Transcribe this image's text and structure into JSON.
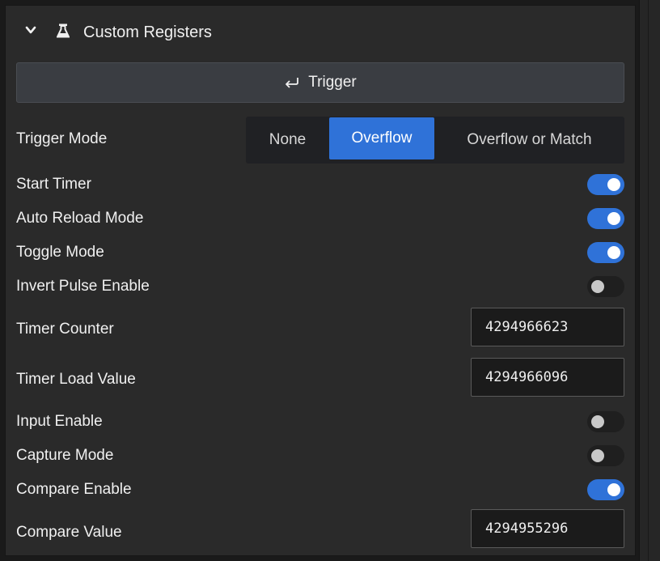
{
  "section": {
    "title": "Custom Registers",
    "collapse_icon": "chevron-down-icon",
    "icon": "flask-icon"
  },
  "trigger_button": {
    "label": "Trigger",
    "icon": "enter-return-icon"
  },
  "trigger_mode": {
    "label": "Trigger Mode",
    "options": [
      "None",
      "Overflow",
      "Overflow or Match"
    ],
    "selected": "Overflow"
  },
  "fields": {
    "start_timer": {
      "label": "Start Timer",
      "enabled": true
    },
    "auto_reload_mode": {
      "label": "Auto Reload Mode",
      "enabled": true
    },
    "toggle_mode": {
      "label": "Toggle Mode",
      "enabled": true
    },
    "invert_pulse_enable": {
      "label": "Invert Pulse Enable",
      "enabled": false
    },
    "timer_counter": {
      "label": "Timer Counter",
      "value": "4294966623"
    },
    "timer_load_value": {
      "label": "Timer Load Value",
      "value": "4294966096"
    },
    "input_enable": {
      "label": "Input Enable",
      "enabled": false
    },
    "capture_mode": {
      "label": "Capture Mode",
      "enabled": false
    },
    "compare_enable": {
      "label": "Compare Enable",
      "enabled": true
    },
    "compare_value": {
      "label": "Compare Value",
      "value": "4294955296"
    }
  },
  "colors": {
    "accent": "#2f72d8",
    "panel_bg": "#2a2a2a",
    "input_bg": "#1b1b1b"
  }
}
